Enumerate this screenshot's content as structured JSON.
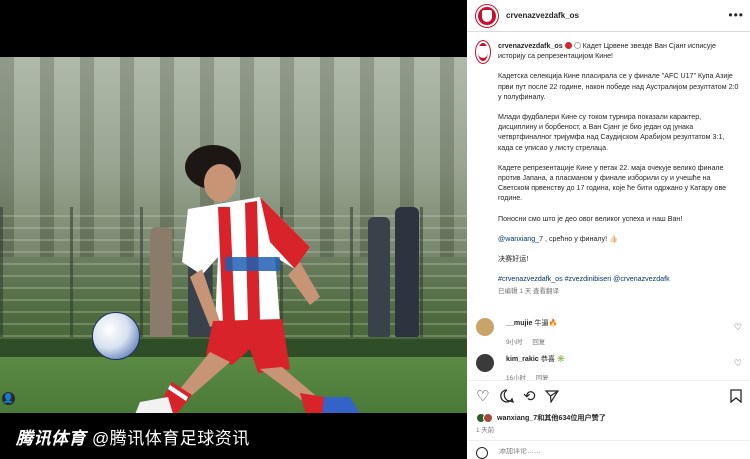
{
  "media": {
    "watermark_brand": "腾讯体育",
    "watermark_handle": "@腾讯体育足球资讯",
    "tag_glyph": "👤"
  },
  "header": {
    "username": "crvenazvezdafk_os",
    "more_glyph": "•••"
  },
  "caption": {
    "username": "crvenazvezdafk_os",
    "paragraphs": [
      "Кадет Црвене звезде Ван Сјанг исписује историју са репрезентацијом Кине!",
      "Кадетска селекција Кине пласирала се у финале \"AFC U17\" Купа Азије први пут после 22 године, након победе над Аустралијом резултатом 2:0 у полуфиналу.",
      "Млади фудбалери Кине су током турнира показали карактер, дисциплину и борбеност, а Ван Сјанг је био један од јунака четвртфиналног тријумфа над Саудијском Арабијом резултатом 3:1, када се уписао у листу стрелаца.",
      "Кадете репрезентације Кине у петак 22. маја очекује велико финале против Јапана, а пласманом у финале изборили су и учешће на Светском првенству до 17 година, које ће бити одржано у Катару ове године.",
      "Поносни смо што је део овог великог успеха и наш Ван!",
      "",
      "决赛好运!"
    ],
    "mention": "@wanxiang_7",
    "mention_tail": " , срећно у финалу! 👍🏻",
    "hashtags": "#crvenazvezdafk_os #zvezdinibiseri @crvenazvezdafk",
    "meta_edited": "已编辑",
    "meta_time": "1 天",
    "meta_translate": "查看翻译"
  },
  "comments": [
    {
      "user": "__mujie",
      "text": "牛逼🔥",
      "time": "9小时",
      "reply": "回复",
      "avatar_color": "#c9a46a"
    },
    {
      "user": "kim_rakic",
      "text": "恭喜 ✳️",
      "time": "16小时",
      "reply": "回复",
      "avatar_color": "#3a3a3a"
    }
  ],
  "actions": {
    "like_glyph": "♡",
    "comment_glyph": "💬",
    "share_glyph": "➤",
    "repost_glyph": "⟲",
    "save_glyph": "🔖"
  },
  "likes": {
    "text": "wanxiang_7和其他634位用户赞了",
    "avatar_colors": [
      "#2e5a2a",
      "#a14a3c"
    ]
  },
  "post_time": "1 天前",
  "comment_input": {
    "placeholder": "添加评论……"
  },
  "colors": {
    "brand_red": "#c8102e",
    "link_blue": "#00376b",
    "muted": "#737373"
  }
}
